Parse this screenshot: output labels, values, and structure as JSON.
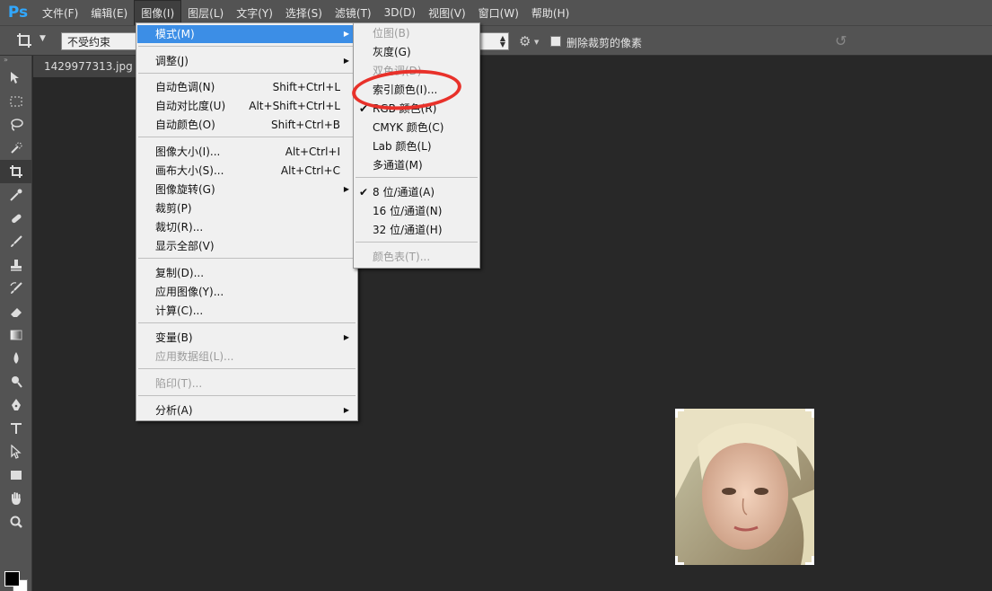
{
  "menubar": {
    "logo": "Ps",
    "items": [
      "文件(F)",
      "编辑(E)",
      "图像(I)",
      "图层(L)",
      "文字(Y)",
      "选择(S)",
      "滤镜(T)",
      "3D(D)",
      "视图(V)",
      "窗口(W)",
      "帮助(H)"
    ]
  },
  "options": {
    "constraint": "不受约束",
    "delete_cropped_label": "删除裁剪的像素"
  },
  "document": {
    "tab_title": "1429977313.jpg @"
  },
  "image_menu": {
    "items": [
      {
        "label": "模式(M)",
        "arrow": "▶"
      },
      {
        "label": "调整(J)",
        "arrow": "▶"
      },
      {
        "label": "自动色调(N)",
        "shortcut": "Shift+Ctrl+L"
      },
      {
        "label": "自动对比度(U)",
        "shortcut": "Alt+Shift+Ctrl+L"
      },
      {
        "label": "自动颜色(O)",
        "shortcut": "Shift+Ctrl+B"
      },
      {
        "label": "图像大小(I)...",
        "shortcut": "Alt+Ctrl+I"
      },
      {
        "label": "画布大小(S)...",
        "shortcut": "Alt+Ctrl+C"
      },
      {
        "label": "图像旋转(G)",
        "arrow": "▶"
      },
      {
        "label": "裁剪(P)"
      },
      {
        "label": "裁切(R)..."
      },
      {
        "label": "显示全部(V)"
      },
      {
        "label": "复制(D)..."
      },
      {
        "label": "应用图像(Y)..."
      },
      {
        "label": "计算(C)..."
      },
      {
        "label": "变量(B)",
        "arrow": "▶"
      },
      {
        "label": "应用数据组(L)..."
      },
      {
        "label": "陷印(T)..."
      },
      {
        "label": "分析(A)",
        "arrow": "▶"
      }
    ]
  },
  "mode_menu": {
    "items": [
      {
        "label": "位图(B)"
      },
      {
        "label": "灰度(G)"
      },
      {
        "label": "双色调(D)"
      },
      {
        "label": "索引颜色(I)..."
      },
      {
        "label": "RGB 颜色(R)",
        "check": "✔"
      },
      {
        "label": "CMYK 颜色(C)"
      },
      {
        "label": "Lab 颜色(L)"
      },
      {
        "label": "多通道(M)"
      },
      {
        "label": "8 位/通道(A)",
        "check": "✔"
      },
      {
        "label": "16 位/通道(N)"
      },
      {
        "label": "32 位/通道(H)"
      },
      {
        "label": "颜色表(T)..."
      }
    ]
  },
  "colors": {
    "accent": "#3c8ee6",
    "annotation": "#e8312a"
  }
}
